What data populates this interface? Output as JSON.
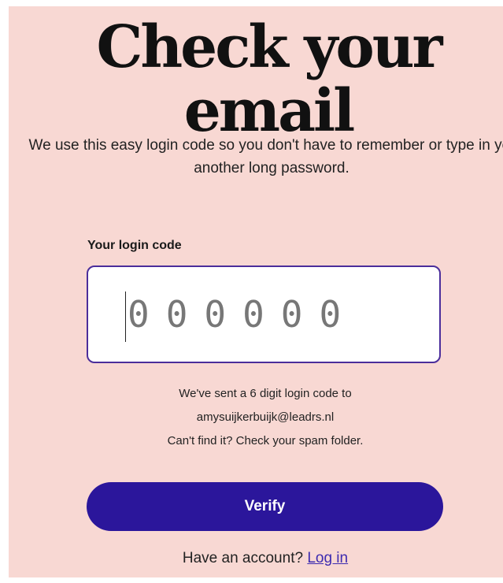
{
  "header": {
    "title": "Check your email",
    "subtitle": "We use this easy login code so you don't have to remember or type in yet another long password."
  },
  "code_field": {
    "label": "Your login code",
    "value": "",
    "placeholder": "000000"
  },
  "info": {
    "line1": "We've sent a 6 digit login code to",
    "email": "amysuijkerbuijk@leadrs.nl",
    "line3": "Can't find it? Check your spam folder."
  },
  "verify_button": {
    "label": "Verify"
  },
  "account": {
    "prompt": "Have an account?",
    "link_label": "Log in"
  },
  "colors": {
    "background": "#f8d8d3",
    "accent": "#2b169b",
    "input_border": "#4b2e9b",
    "link": "#3d2bb0"
  }
}
